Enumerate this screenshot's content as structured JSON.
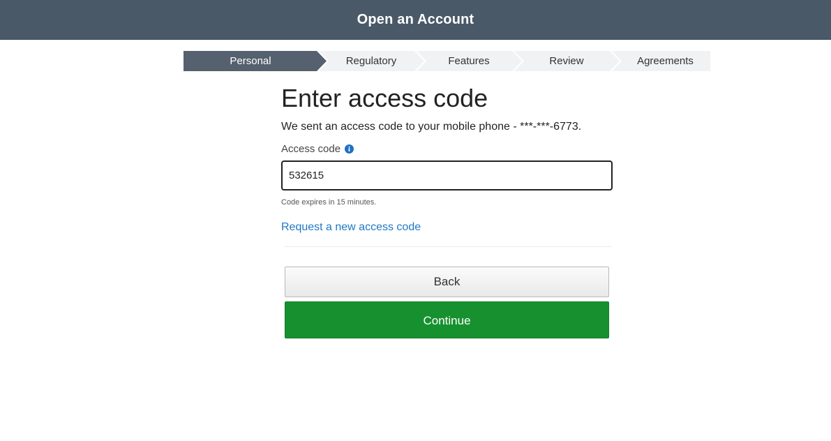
{
  "header": {
    "title": "Open an Account"
  },
  "steps": [
    {
      "label": "Personal",
      "active": true
    },
    {
      "label": "Regulatory",
      "active": false
    },
    {
      "label": "Features",
      "active": false
    },
    {
      "label": "Review",
      "active": false
    },
    {
      "label": "Agreements",
      "active": false
    }
  ],
  "main": {
    "heading": "Enter access code",
    "sent_text": "We sent an access code to your mobile phone - ***-***-6773.",
    "field_label": "Access code",
    "field_value": "532615",
    "hint": "Code expires in 15 minutes.",
    "request_link": "Request a new access code"
  },
  "buttons": {
    "back": "Back",
    "continue": "Continue"
  },
  "colors": {
    "header_bg": "#4a5968",
    "step_active": "#55616f",
    "step_inactive": "#f0f2f3",
    "link": "#1f78c4",
    "continue_bg": "#17912f",
    "info_icon": "#1f6fc4"
  },
  "icons": {
    "info": "info-icon"
  }
}
